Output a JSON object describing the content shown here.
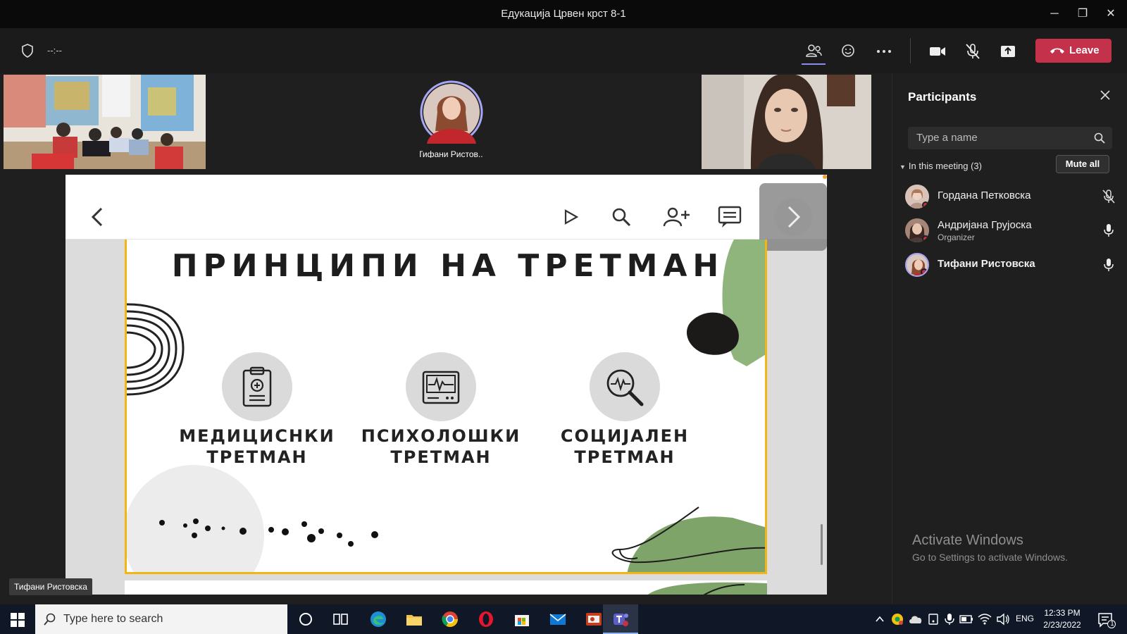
{
  "window": {
    "title": "Едукација Црвен крст 8-1"
  },
  "toolbar": {
    "timer": "--:--",
    "leave_label": "Leave"
  },
  "stage": {
    "center_participant_name": "Тифани Ристов...",
    "name_tag": "Тифани Ристовска"
  },
  "slide": {
    "title": "ПРИНЦИПИ НА ТРЕТМАН",
    "items": [
      {
        "line1": "МЕДИЦИСНКИ",
        "line2": "ТРЕТМАН",
        "icon": "clipboard-icon"
      },
      {
        "line1": "ПСИХОЛОШКИ",
        "line2": "ТРЕТМАН",
        "icon": "heart-monitor-icon"
      },
      {
        "line1": "СОЦИЈАЛЕН",
        "line2": "ТРЕТМАН",
        "icon": "magnifier-pulse-icon"
      }
    ]
  },
  "participants_panel": {
    "title": "Participants",
    "search_placeholder": "Type a name",
    "section_label": "In this meeting (3)",
    "mute_all_label": "Mute all",
    "people": [
      {
        "name": "Гордана Петковска",
        "role": "",
        "mic": "muted"
      },
      {
        "name": "Андријана Грујоска",
        "role": "Organizer",
        "mic": "on"
      },
      {
        "name": "Тифани Ристовска",
        "role": "",
        "mic": "on"
      }
    ],
    "activate_title": "Activate Windows",
    "activate_sub": "Go to Settings to activate Windows."
  },
  "taskbar": {
    "search_placeholder": "Type here to search",
    "lang": "ENG",
    "time": "12:33 PM",
    "date": "2/23/2022",
    "notification_count": "1"
  },
  "colors": {
    "leave": "#c4314b",
    "slide_border": "#f2b515",
    "accent_green": "#7ea46a"
  }
}
